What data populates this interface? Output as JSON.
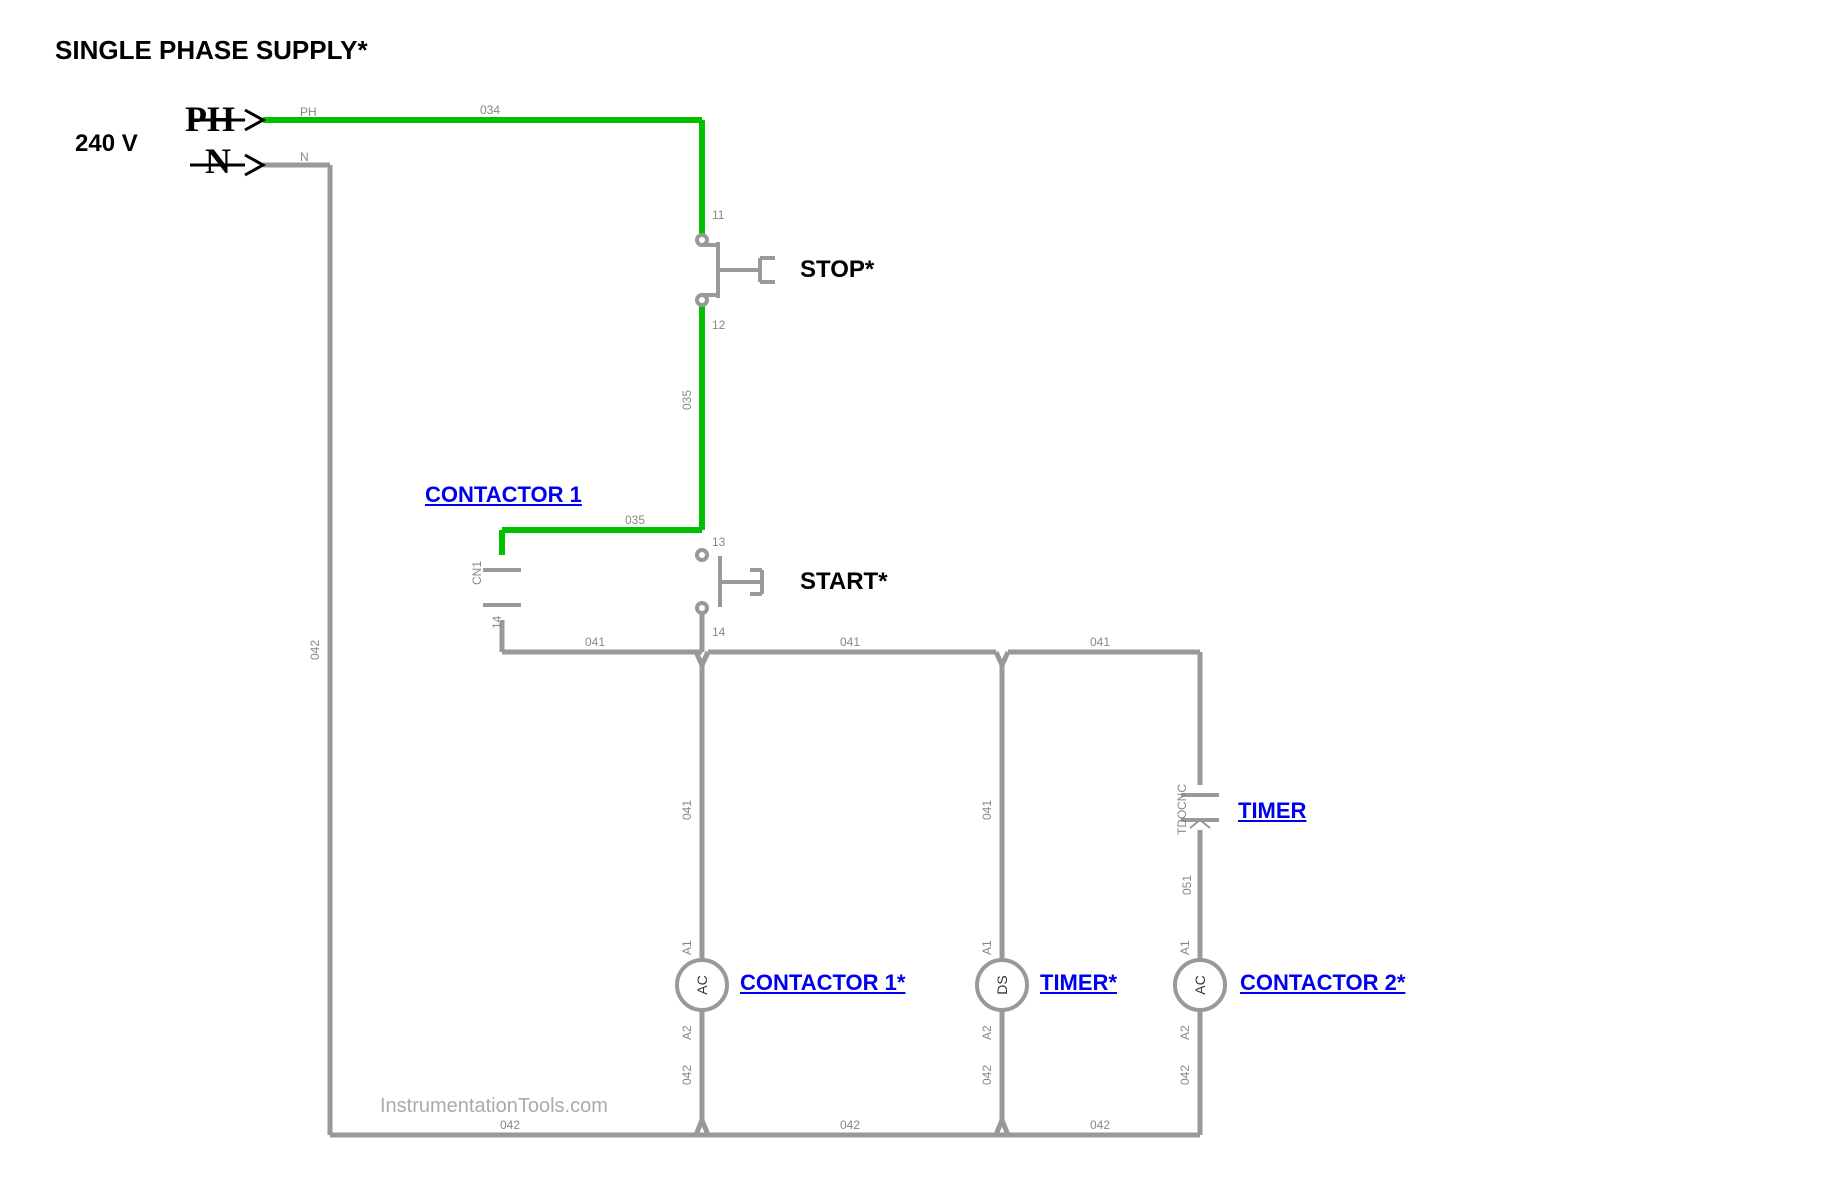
{
  "title": "SINGLE PHASE SUPPLY*",
  "voltage": "240 V",
  "phase_label": "PH",
  "neutral_label": "N",
  "buttons": {
    "stop": "STOP*",
    "start": "START*"
  },
  "components": {
    "contactor1_top": "CONTACTOR 1",
    "contactor1_coil": "CONTACTOR 1*",
    "timer_contact": "TIMER",
    "timer_coil": "TIMER*",
    "contactor2_coil": "CONTACTOR 2*"
  },
  "wire_labels": {
    "ph": "PH",
    "n": "N",
    "w034": "034",
    "w035": "035",
    "w041": "041",
    "w042": "042",
    "w051": "051",
    "t11": "11",
    "t12": "12",
    "t13": "13",
    "t14": "14",
    "a1": "A1",
    "a2": "A2",
    "cn1": "CN1",
    "cnc": "CNC",
    "tdo": "TDO",
    "ds": "DS",
    "ac": "AC"
  },
  "watermark": "InstrumentationTools.com"
}
